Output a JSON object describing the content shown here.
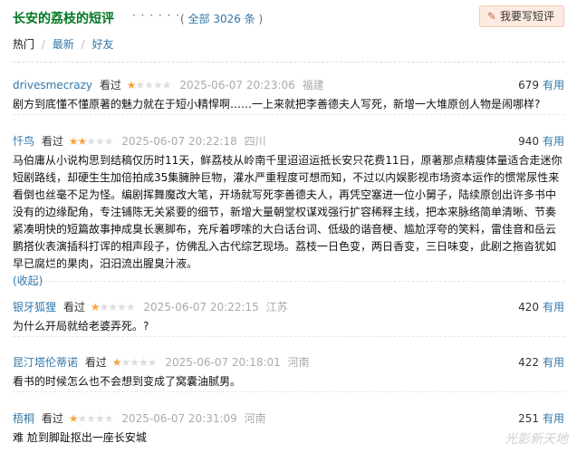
{
  "header": {
    "title": "长安的荔枝的短评",
    "dots": "· · · · · ·",
    "count_label": "( 全部 3026 条 )",
    "count_prefix": "(",
    "count_all": "全部 3026 条",
    "count_suffix": ")",
    "write_button": "我要写短评"
  },
  "tabs": {
    "hot": "热门",
    "sep1": "/",
    "latest": "最新",
    "sep2": "/",
    "friends": "好友"
  },
  "reviews": [
    {
      "user": "drivesmecrazy",
      "seen": "看过",
      "rating": 1,
      "time": "2025-06-07 20:23:06",
      "location": "福建",
      "votes": "679",
      "useful": "有用",
      "content": "剧方到底懂不懂原著的魅力就在于短小精悍啊……一上来就把李善德夫人写死，新增一大堆原创人物是闹哪样?"
    },
    {
      "user": "忏鸟",
      "seen": "看过",
      "rating": 2,
      "time": "2025-06-07 20:22:18",
      "location": "四川",
      "votes": "940",
      "useful": "有用",
      "content": "马伯庸从小说构思到结稿仅历时11天，鲜荔枝从岭南千里迢迢运抵长安只花费11日，原著那点精瘦体量适合走迷你短剧路线，却硬生生加倍拍成35集臃肿巨物，灌水严重程度可想而知，不过以内娱影视市场资本运作的惯常尿性来看倒也丝毫不足为怪。编剧挥舞魔改大笔，开场就写死李善德夫人，再凭空塞进一位小舅子，陆续原创出许多书中没有的边缘配角，专注铺陈无关紧要的细节，新增大量朝堂权谋戏强行扩容稀释主线，把本来脉络简单清晰、节奏紧凑明快的短篇故事抻成臭长裹脚布，充斥着啰嗦的大白话台词、低级的谐音梗、尴尬浮夸的笑料，雷佳音和岳云鹏搭伙表演插科打诨的相声段子，仿佛乱入古代综艺现场。荔枝一日色变，两日香变，三日味变，此剧之拖沓犹如早已腐烂的果肉，汨汨流出腥臭汁液。",
      "collapse": "(收起)"
    },
    {
      "user": "银牙狐狸",
      "seen": "看过",
      "rating": 1,
      "time": "2025-06-07 20:22:15",
      "location": "江苏",
      "votes": "420",
      "useful": "有用",
      "content": "为什么开局就给老婆弄死。?"
    },
    {
      "user": "昆汀塔伦蒂诺",
      "seen": "看过",
      "rating": 1,
      "time": "2025-06-07 20:18:01",
      "location": "河南",
      "votes": "422",
      "useful": "有用",
      "content": "看书的时候怎么也不会想到变成了窝囊油腻男。"
    },
    {
      "user": "梧桐",
      "seen": "看过",
      "rating": 1,
      "time": "2025-06-07 20:31:09",
      "location": "河南",
      "votes": "251",
      "useful": "有用",
      "content": "难 尬到脚趾抠出一座长安城"
    }
  ],
  "watermark": "光影新天地",
  "colors": {
    "title_green": "#007722",
    "link_blue": "#3377aa",
    "star_on": "#f6a53d",
    "star_off": "#dddddd",
    "button_bg": "#fdebe1"
  }
}
